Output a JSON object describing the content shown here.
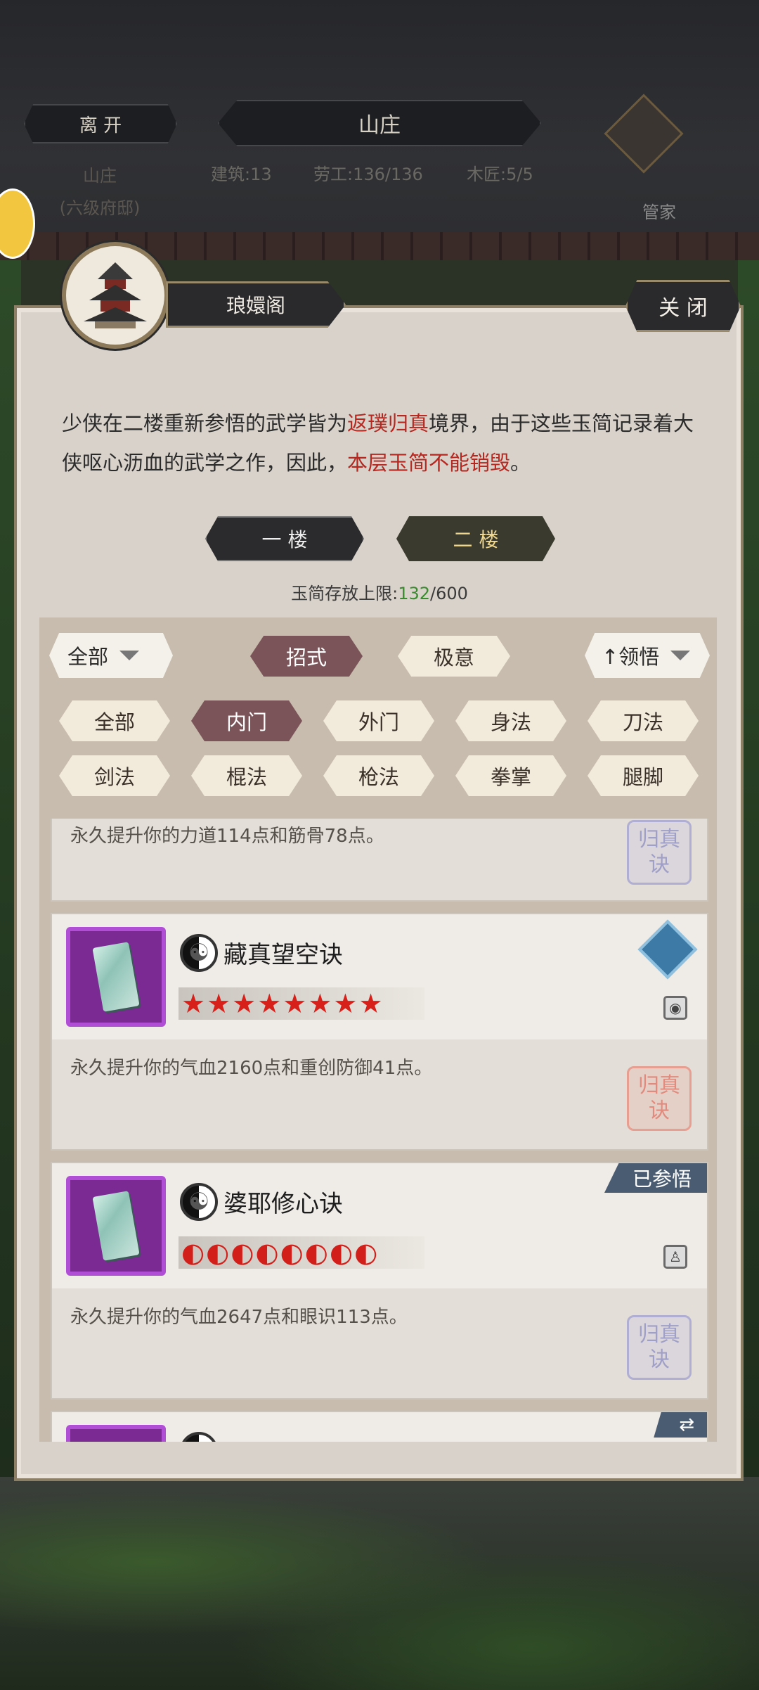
{
  "top": {
    "leave_label": "离 开",
    "location_title": "山庄",
    "place_name": "山庄",
    "place_level": "(六级府邸)",
    "stats": [
      "建筑:13",
      "劳工:136/136",
      "木匠:5/5"
    ],
    "steward_label": "管家"
  },
  "panel": {
    "title": "琅嬛阁",
    "close_label": "关 闭",
    "intro_parts": [
      "少侠在二楼重新参悟的武学皆为",
      "返璞归真",
      "境界，由于这些玉简记录着大侠呕心沥血的武学之作，因此，",
      "本层玉简不能销毁",
      "。"
    ],
    "floors": [
      "一 楼",
      "二 楼"
    ],
    "selected_floor": "二 楼",
    "capacity_label": "玉简存放上限:",
    "capacity_used": "132",
    "capacity_total": "/600"
  },
  "filters": {
    "scope_dropdown": "全部",
    "type_tabs": [
      "招式",
      "极意"
    ],
    "selected_type": "招式",
    "sort_dropdown": "↑领悟",
    "categories": [
      "全部",
      "内门",
      "外门",
      "身法",
      "刀法",
      "剑法",
      "棍法",
      "枪法",
      "拳掌",
      "腿脚"
    ],
    "selected_category": "内门"
  },
  "list": {
    "partial_top_desc": "永久提升你的力道114点和筋骨78点。",
    "items": [
      {
        "name": "藏真望空诀",
        "rating": "★★★★★★★★",
        "desc": "永久提升你的气血2160点和重创防御41点。",
        "seal_text": "归真诀",
        "badge": "",
        "marker": "book-icon"
      },
      {
        "name": "婆耶修心诀",
        "rating": "◐◐◐◐◐◐◐◐",
        "desc": "永久提升你的气血2647点和眼识113点。",
        "seal_text": "归真诀",
        "badge": "已参悟",
        "marker": "meditate-icon"
      }
    ]
  },
  "colors": {
    "accent_red": "#b5271f",
    "capacity_green": "#3a8a2e",
    "selected_chip": "#7a5458",
    "badge": "#4a5c72"
  }
}
